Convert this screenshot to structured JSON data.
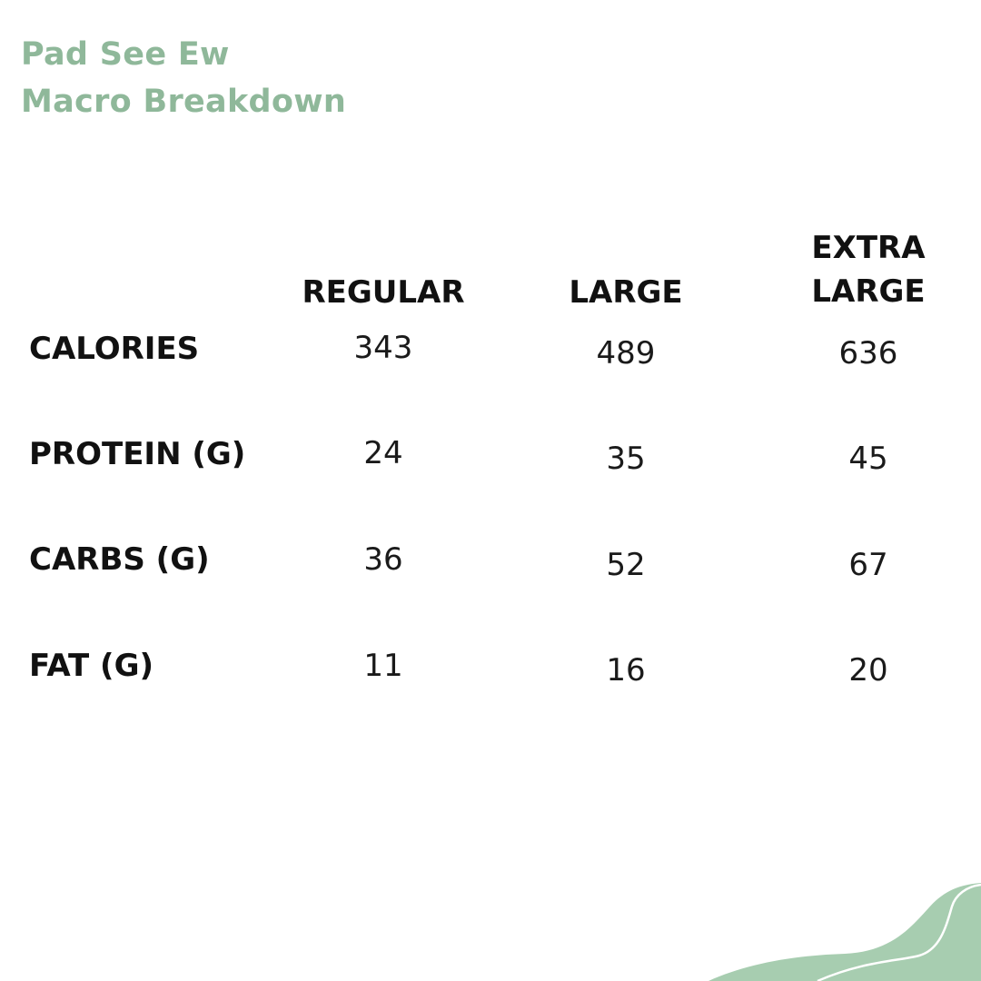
{
  "title": {
    "line1": "Pad See Ew",
    "line2": "Macro Breakdown"
  },
  "columns": {
    "regular": "REGULAR",
    "large": "LARGE",
    "extra_large_line1": "EXTRA",
    "extra_large_line2": "LARGE"
  },
  "rows": [
    {
      "label": "CALORIES",
      "regular": "343",
      "large": "489",
      "extra_large": "636"
    },
    {
      "label": "PROTEIN (G)",
      "regular": "24",
      "large": "35",
      "extra_large": "45"
    },
    {
      "label": "CARBS (G)",
      "regular": "36",
      "large": "52",
      "extra_large": "67"
    },
    {
      "label": "FAT (G)",
      "regular": "11",
      "large": "16",
      "extra_large": "20"
    }
  ],
  "colors": {
    "title": "#8fb89a",
    "text": "#111111",
    "wave": "#a7cdb0",
    "background": "#ffffff"
  }
}
